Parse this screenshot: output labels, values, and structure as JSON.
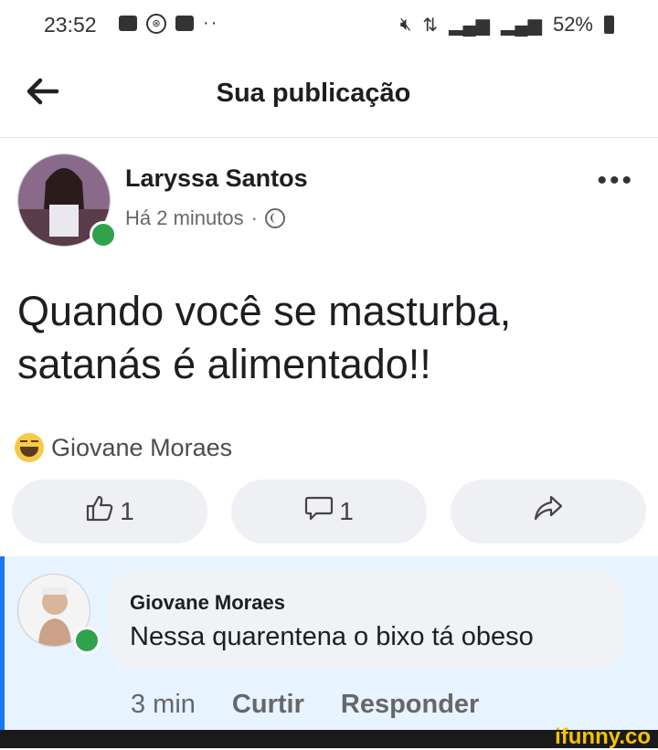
{
  "status_bar": {
    "time": "23:52",
    "dots": "··",
    "battery": "52%"
  },
  "header": {
    "title": "Sua publicação"
  },
  "post": {
    "author": "Laryssa Santos",
    "time": "Há 2 minutos",
    "separator": "·",
    "text": "Quando você se masturba, satanás é alimentado!!",
    "reactor": "Giovane Moraes",
    "like_count": "1",
    "comment_count": "1"
  },
  "comment": {
    "author": "Giovane Moraes",
    "text": "Nessa quarentena o bixo tá obeso",
    "time": "3 min",
    "like_label": "Curtir",
    "reply_label": "Responder"
  },
  "watermark": "ifunny.co",
  "colors": {
    "accent": "#1877f2",
    "online": "#31a24c",
    "comment_bg": "#e7f3ff"
  }
}
